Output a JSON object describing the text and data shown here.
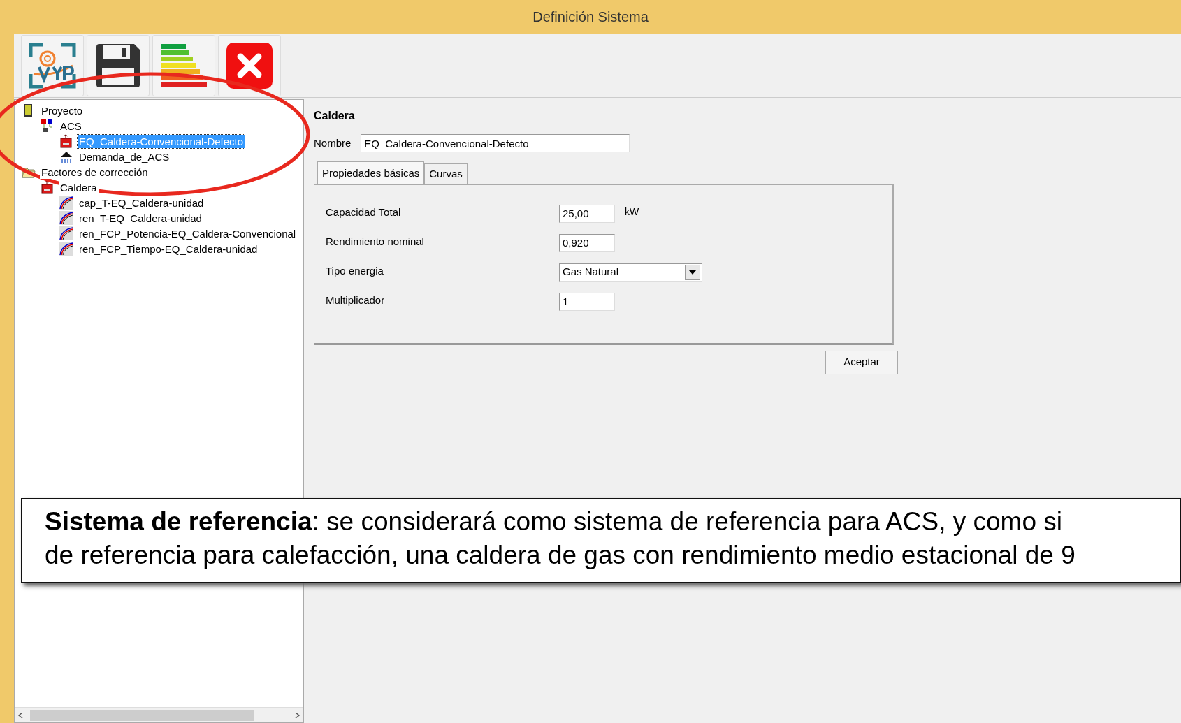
{
  "window": {
    "title": "Definición Sistema"
  },
  "tree": [
    {
      "label": "Proyecto",
      "kind": "building",
      "selected": false,
      "children": [
        {
          "label": "ACS",
          "kind": "system",
          "selected": false,
          "children": [
            {
              "label": "EQ_Caldera-Convencional-Defecto",
              "kind": "boiler",
              "selected": true
            },
            {
              "label": "Demanda_de_ACS",
              "kind": "shower",
              "selected": false
            }
          ]
        }
      ]
    },
    {
      "label": "Factores de corrección",
      "kind": "folder",
      "selected": false,
      "children": [
        {
          "label": "Caldera",
          "kind": "boiler",
          "selected": false,
          "children": [
            {
              "label": "cap_T-EQ_Caldera-unidad",
              "kind": "curve",
              "selected": false
            },
            {
              "label": "ren_T-EQ_Caldera-unidad",
              "kind": "curve",
              "selected": false
            },
            {
              "label": "ren_FCP_Potencia-EQ_Caldera-Convencional",
              "kind": "curve",
              "selected": false
            },
            {
              "label": "ren_FCP_Tiempo-EQ_Caldera-unidad",
              "kind": "curve",
              "selected": false
            }
          ]
        }
      ]
    }
  ],
  "panel": {
    "title": "Caldera",
    "name_label": "Nombre",
    "name_value": "EQ_Caldera-Convencional-Defecto",
    "tabs": [
      {
        "label": "Propiedades básicas",
        "selected": true
      },
      {
        "label": "Curvas",
        "selected": false
      }
    ],
    "fields": [
      {
        "label": "Capacidad Total",
        "value": "25,00",
        "unit": "kW",
        "kind": "text"
      },
      {
        "label": "Rendimiento nominal",
        "value": "0,920",
        "kind": "text"
      },
      {
        "label": "Tipo energia",
        "value": "Gas Natural",
        "kind": "dropdown"
      },
      {
        "label": "Multiplicador",
        "value": "1",
        "kind": "text"
      }
    ],
    "button": "Aceptar"
  },
  "annotation": {
    "text": "**Sistema de referencia**: se considerará como sistema de referencia para ACS, y como si",
    "text_2": "de referencia para calefacción, una caldera de gas con rendimiento medio estacional de 9"
  }
}
